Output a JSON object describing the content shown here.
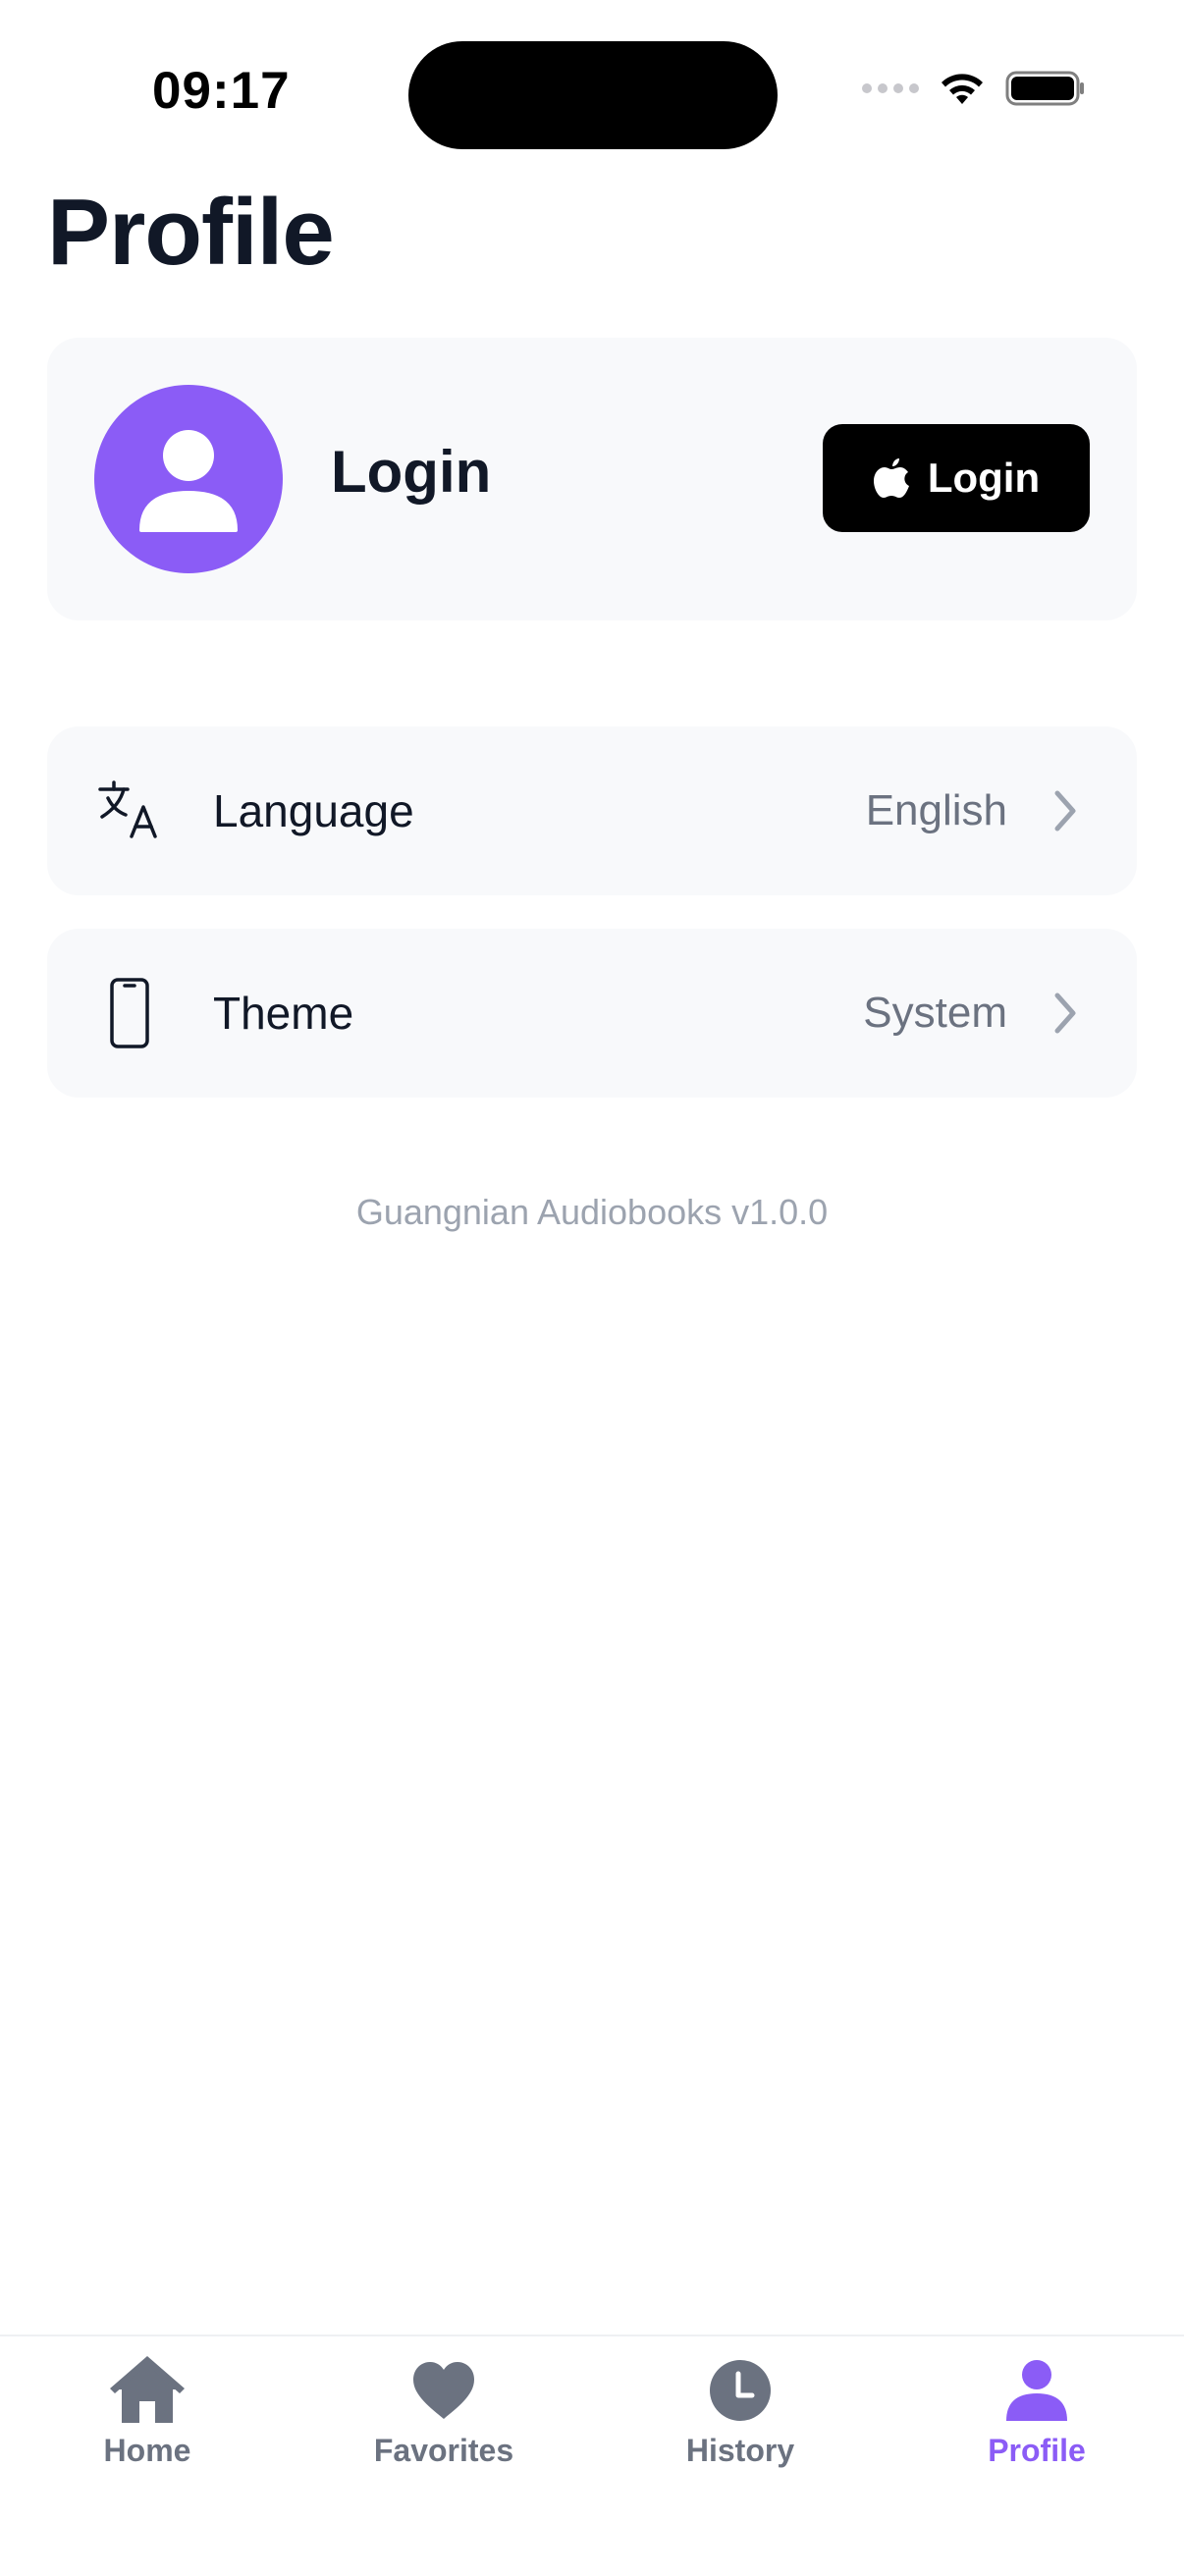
{
  "status_bar": {
    "time": "09:17"
  },
  "page": {
    "title": "Profile"
  },
  "account": {
    "name": "Login",
    "login_button_label": "Login",
    "avatar_color": "#8b5cf6"
  },
  "settings": {
    "language": {
      "label": "Language",
      "value": "English",
      "icon": "translate-icon"
    },
    "theme": {
      "label": "Theme",
      "value": "System",
      "icon": "phone-icon"
    }
  },
  "footer": {
    "version": "Guangnian Audiobooks v1.0.0"
  },
  "tab_bar": {
    "active_color": "#8b5cf6",
    "inactive_color": "#6b7280",
    "tabs": [
      {
        "label": "Home",
        "icon": "home-icon"
      },
      {
        "label": "Favorites",
        "icon": "heart-icon"
      },
      {
        "label": "History",
        "icon": "clock-icon"
      },
      {
        "label": "Profile",
        "icon": "person-icon",
        "active": true
      }
    ]
  }
}
